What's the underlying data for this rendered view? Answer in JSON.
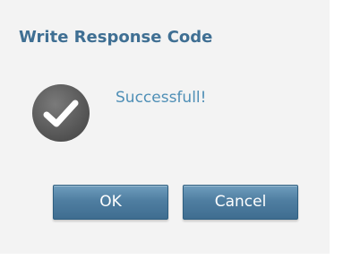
{
  "dialog": {
    "title": "Write Response Code",
    "message": "Successfull!",
    "icon": "checkmark-circle-icon",
    "buttons": {
      "ok_label": "OK",
      "cancel_label": "Cancel"
    }
  },
  "colors": {
    "title": "#3f6f93",
    "message": "#4f8fb6",
    "button": "#4f7ea1",
    "icon": "#5a5a5a"
  }
}
